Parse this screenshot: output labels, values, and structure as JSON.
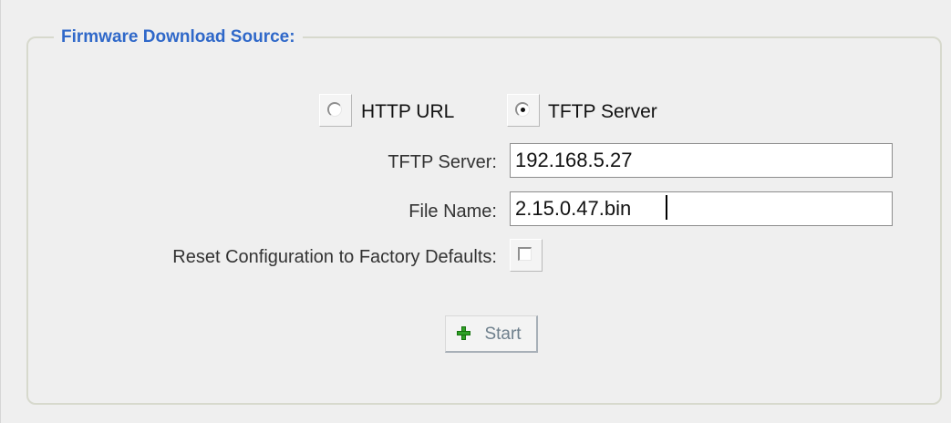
{
  "section": {
    "title": "Firmware Download Source:"
  },
  "source_options": [
    {
      "label": "HTTP URL",
      "selected": false
    },
    {
      "label": "TFTP Server",
      "selected": true
    }
  ],
  "fields": {
    "tftp_server": {
      "label": "TFTP Server:",
      "value": "192.168.5.27"
    },
    "file_name": {
      "label": "File Name:",
      "value": "2.15.0.47.bin"
    },
    "reset_defaults": {
      "label": "Reset Configuration to Factory Defaults:",
      "checked": false
    }
  },
  "actions": {
    "start_label": "Start"
  },
  "icons": {
    "start": "plus-icon"
  },
  "colors": {
    "title": "#2f68c9",
    "start_icon": "#2fa126"
  }
}
